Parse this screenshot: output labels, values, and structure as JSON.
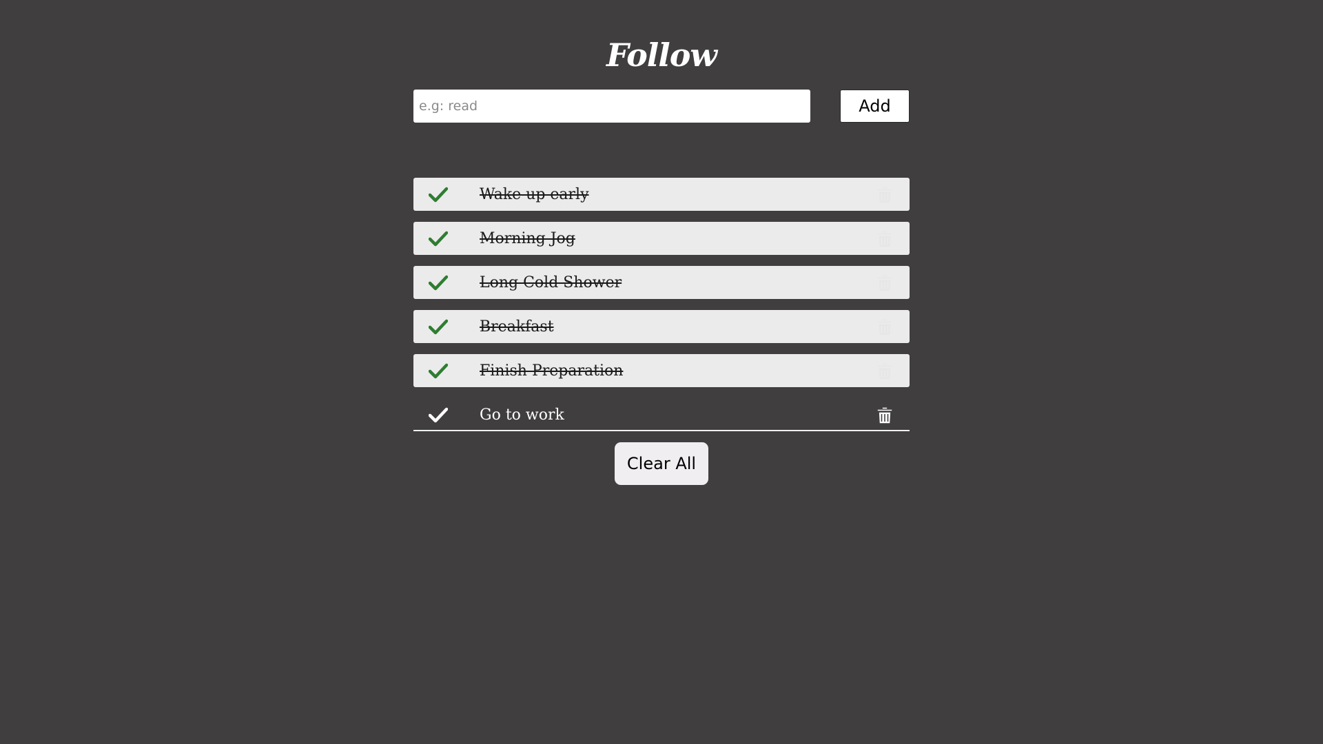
{
  "header": {
    "title": "Follow"
  },
  "form": {
    "placeholder": "e.g: read",
    "value": "",
    "add_label": "Add"
  },
  "tasks": [
    {
      "text": "Wake up early",
      "done": true
    },
    {
      "text": "Morning Jog",
      "done": true
    },
    {
      "text": "Long Cold Shower",
      "done": true
    },
    {
      "text": "Breakfast",
      "done": true
    },
    {
      "text": "Finish Preparation",
      "done": true
    },
    {
      "text": "Go to work",
      "done": false
    }
  ],
  "footer": {
    "clear_label": "Clear All"
  },
  "colors": {
    "background": "#403e3f",
    "done_check": "#2e7d32",
    "pending_check": "#ffffff",
    "done_row": "#ebebeb",
    "done_trash": "#e6e6e6",
    "pending_trash": "#ffffff"
  },
  "icons": {
    "check": "check-icon",
    "trash": "trash-icon"
  }
}
